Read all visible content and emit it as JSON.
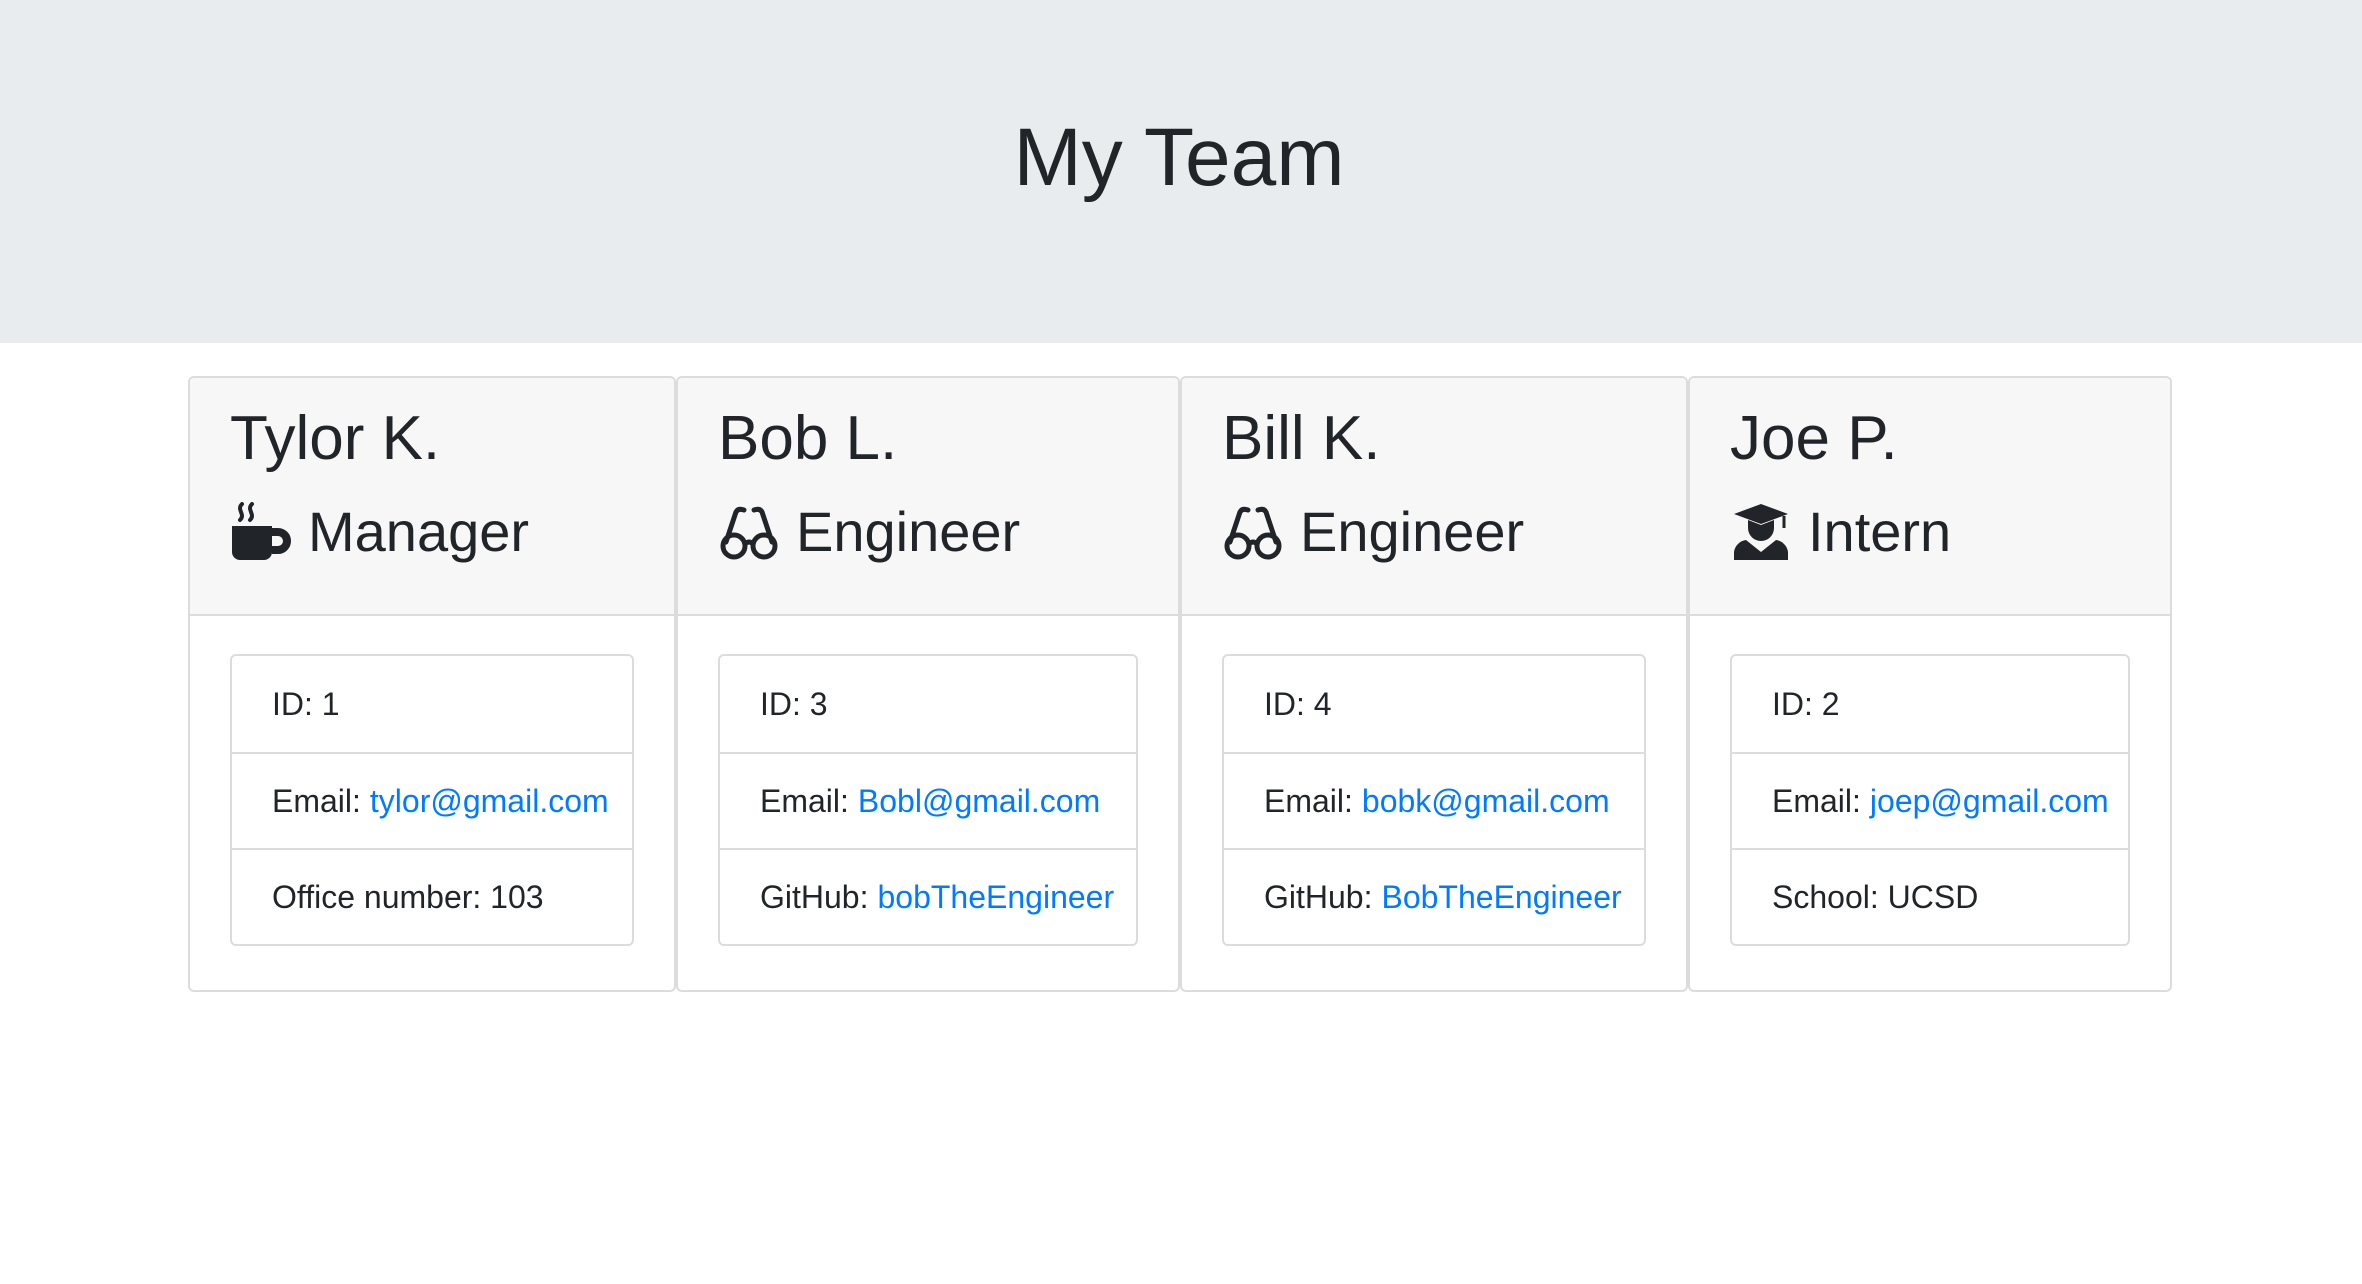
{
  "header": {
    "title": "My Team"
  },
  "colors": {
    "jumbotron_bg": "#e9ecef",
    "link": "#007bff",
    "header_bg": "#f7f7f7"
  },
  "members": [
    {
      "name": "Tylor K.",
      "role": "Manager",
      "icon": "coffee-icon",
      "id_label": "ID: 1",
      "email_label": "Email:",
      "email": "tylor@gmail.com",
      "extra_label": "Office number: 103",
      "extra_link": ""
    },
    {
      "name": "Bob L.",
      "role": "Engineer",
      "icon": "glasses-icon",
      "id_label": "ID: 3",
      "email_label": "Email:",
      "email": "Bobl@gmail.com",
      "extra_label": "GitHub:",
      "extra_link": "bobTheEngineer"
    },
    {
      "name": "Bill K.",
      "role": "Engineer",
      "icon": "glasses-icon",
      "id_label": "ID: 4",
      "email_label": "Email:",
      "email": "bobk@gmail.com",
      "extra_label": "GitHub:",
      "extra_link": "BobTheEngineer"
    },
    {
      "name": "Joe P.",
      "role": "Intern",
      "icon": "graduate-icon",
      "id_label": "ID: 2",
      "email_label": "Email:",
      "email": "joep@gmail.com",
      "extra_label": "School: UCSD",
      "extra_link": ""
    }
  ]
}
